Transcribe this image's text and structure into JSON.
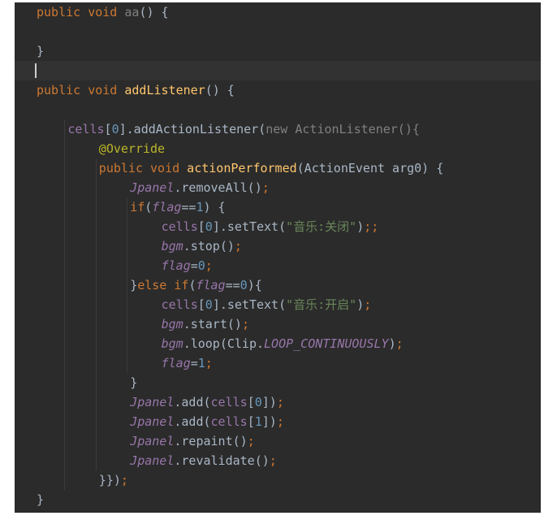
{
  "editor": {
    "lines": [
      {
        "indent": "",
        "tokens": [
          {
            "t": "public",
            "c": "kw"
          },
          {
            "t": " ",
            "c": "pl"
          },
          {
            "t": "void",
            "c": "kw"
          },
          {
            "t": " ",
            "c": "pl"
          },
          {
            "t": "aa",
            "c": "dim"
          },
          {
            "t": "() {",
            "c": "pl"
          }
        ]
      },
      {
        "indent": "",
        "tokens": []
      },
      {
        "indent": "",
        "tokens": [
          {
            "t": "}",
            "c": "pl"
          }
        ]
      },
      {
        "indent": "",
        "tokens": []
      },
      {
        "indent": "",
        "tokens": [
          {
            "t": "public",
            "c": "kw"
          },
          {
            "t": " ",
            "c": "pl"
          },
          {
            "t": "void",
            "c": "kw"
          },
          {
            "t": " ",
            "c": "pl"
          },
          {
            "t": "addListener",
            "c": "fn"
          },
          {
            "t": "() {",
            "c": "pl"
          }
        ]
      },
      {
        "indent": "",
        "tokens": []
      },
      {
        "indent": "    ",
        "tokens": [
          {
            "t": "cells",
            "c": "fld2"
          },
          {
            "t": "[",
            "c": "pl"
          },
          {
            "t": "0",
            "c": "num"
          },
          {
            "t": "].addActionListener(",
            "c": "pl"
          },
          {
            "t": "new ActionListener(){",
            "c": "dim"
          }
        ]
      },
      {
        "indent": "        ",
        "tokens": [
          {
            "t": "@Override",
            "c": "ann"
          }
        ]
      },
      {
        "indent": "        ",
        "tokens": [
          {
            "t": "public",
            "c": "kw"
          },
          {
            "t": " ",
            "c": "pl"
          },
          {
            "t": "void",
            "c": "kw"
          },
          {
            "t": " ",
            "c": "pl"
          },
          {
            "t": "actionPerformed",
            "c": "fn"
          },
          {
            "t": "(ActionEvent arg0) {",
            "c": "pl"
          }
        ]
      },
      {
        "indent": "            ",
        "tokens": [
          {
            "t": "Jpanel",
            "c": "fld"
          },
          {
            "t": ".removeAll()",
            "c": "pl"
          },
          {
            "t": ";",
            "c": "kw"
          }
        ]
      },
      {
        "indent": "            ",
        "tokens": [
          {
            "t": "if",
            "c": "kw"
          },
          {
            "t": "(",
            "c": "pl"
          },
          {
            "t": "flag",
            "c": "fld"
          },
          {
            "t": "==",
            "c": "pl"
          },
          {
            "t": "1",
            "c": "num"
          },
          {
            "t": ") {",
            "c": "pl"
          }
        ]
      },
      {
        "indent": "                ",
        "tokens": [
          {
            "t": "cells",
            "c": "fld2"
          },
          {
            "t": "[",
            "c": "pl"
          },
          {
            "t": "0",
            "c": "num"
          },
          {
            "t": "].setText(",
            "c": "pl"
          },
          {
            "t": "\"音乐:关闭\"",
            "c": "str"
          },
          {
            "t": ")",
            "c": "pl"
          },
          {
            "t": ";;",
            "c": "kw"
          }
        ]
      },
      {
        "indent": "                ",
        "tokens": [
          {
            "t": "bgm",
            "c": "fld"
          },
          {
            "t": ".stop()",
            "c": "pl"
          },
          {
            "t": ";",
            "c": "kw"
          }
        ]
      },
      {
        "indent": "                ",
        "tokens": [
          {
            "t": "flag",
            "c": "fld"
          },
          {
            "t": "=",
            "c": "pl"
          },
          {
            "t": "0",
            "c": "num"
          },
          {
            "t": ";",
            "c": "kw"
          }
        ]
      },
      {
        "indent": "            ",
        "tokens": [
          {
            "t": "}",
            "c": "pl"
          },
          {
            "t": "else",
            "c": "kw"
          },
          {
            "t": " ",
            "c": "pl"
          },
          {
            "t": "if",
            "c": "kw"
          },
          {
            "t": "(",
            "c": "pl"
          },
          {
            "t": "flag",
            "c": "fld"
          },
          {
            "t": "==",
            "c": "pl"
          },
          {
            "t": "0",
            "c": "num"
          },
          {
            "t": "){",
            "c": "pl"
          }
        ]
      },
      {
        "indent": "                ",
        "tokens": [
          {
            "t": "cells",
            "c": "fld2"
          },
          {
            "t": "[",
            "c": "pl"
          },
          {
            "t": "0",
            "c": "num"
          },
          {
            "t": "].setText(",
            "c": "pl"
          },
          {
            "t": "\"音乐:开启\"",
            "c": "str"
          },
          {
            "t": ")",
            "c": "pl"
          },
          {
            "t": ";",
            "c": "kw"
          }
        ]
      },
      {
        "indent": "                ",
        "tokens": [
          {
            "t": "bgm",
            "c": "fld"
          },
          {
            "t": ".start()",
            "c": "pl"
          },
          {
            "t": ";",
            "c": "kw"
          }
        ]
      },
      {
        "indent": "                ",
        "tokens": [
          {
            "t": "bgm",
            "c": "fld"
          },
          {
            "t": ".loop(Clip.",
            "c": "pl"
          },
          {
            "t": "LOOP_CONTINUOUSLY",
            "c": "cst"
          },
          {
            "t": ")",
            "c": "pl"
          },
          {
            "t": ";",
            "c": "kw"
          }
        ]
      },
      {
        "indent": "                ",
        "tokens": [
          {
            "t": "flag",
            "c": "fld"
          },
          {
            "t": "=",
            "c": "pl"
          },
          {
            "t": "1",
            "c": "num"
          },
          {
            "t": ";",
            "c": "kw"
          }
        ]
      },
      {
        "indent": "            ",
        "tokens": [
          {
            "t": "}",
            "c": "pl"
          }
        ]
      },
      {
        "indent": "            ",
        "tokens": [
          {
            "t": "Jpanel",
            "c": "fld"
          },
          {
            "t": ".add(",
            "c": "pl"
          },
          {
            "t": "cells",
            "c": "fld2"
          },
          {
            "t": "[",
            "c": "pl"
          },
          {
            "t": "0",
            "c": "num"
          },
          {
            "t": "])",
            "c": "pl"
          },
          {
            "t": ";",
            "c": "kw"
          }
        ]
      },
      {
        "indent": "            ",
        "tokens": [
          {
            "t": "Jpanel",
            "c": "fld"
          },
          {
            "t": ".add(",
            "c": "pl"
          },
          {
            "t": "cells",
            "c": "fld2"
          },
          {
            "t": "[",
            "c": "pl"
          },
          {
            "t": "1",
            "c": "num"
          },
          {
            "t": "])",
            "c": "pl"
          },
          {
            "t": ";",
            "c": "kw"
          }
        ]
      },
      {
        "indent": "            ",
        "tokens": [
          {
            "t": "Jpanel",
            "c": "fld"
          },
          {
            "t": ".repaint()",
            "c": "pl"
          },
          {
            "t": ";",
            "c": "kw"
          }
        ]
      },
      {
        "indent": "            ",
        "tokens": [
          {
            "t": "Jpanel",
            "c": "fld"
          },
          {
            "t": ".revalidate()",
            "c": "pl"
          },
          {
            "t": ";",
            "c": "kw"
          }
        ]
      },
      {
        "indent": "        ",
        "tokens": [
          {
            "t": "}})",
            "c": "pl"
          },
          {
            "t": ";",
            "c": "kw"
          }
        ]
      },
      {
        "indent": "",
        "tokens": [
          {
            "t": "}",
            "c": "pl"
          }
        ]
      }
    ]
  }
}
